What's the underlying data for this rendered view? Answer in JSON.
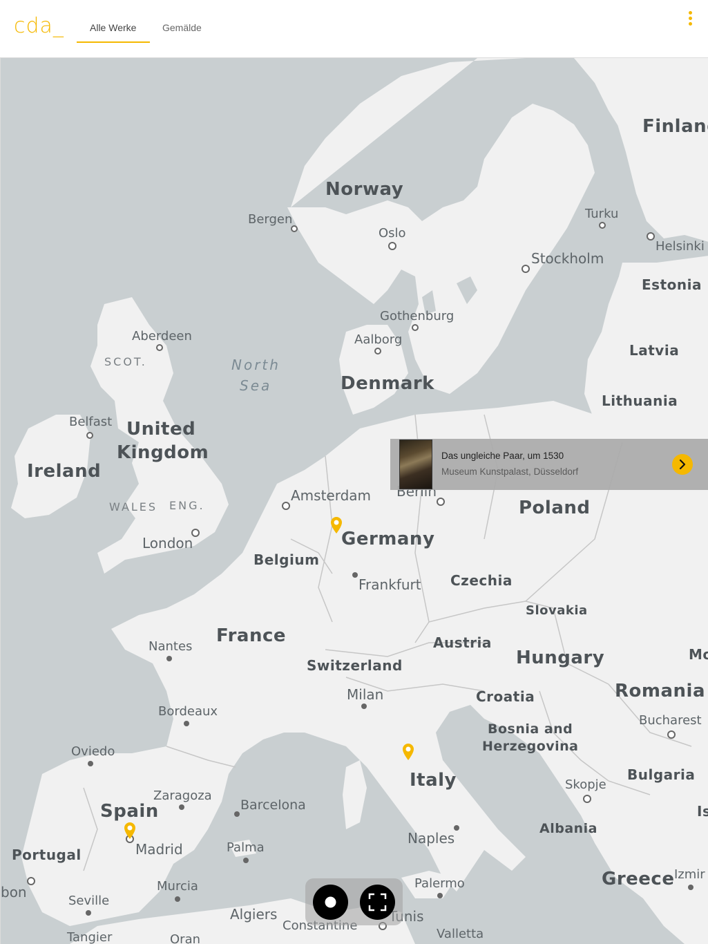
{
  "header": {
    "logo": "cda_",
    "tabs": [
      {
        "label": "Alle Werke",
        "active": true
      },
      {
        "label": "Gemälde",
        "active": false
      }
    ],
    "menu_icon": "more-vertical-icon",
    "accent_color": "#f5b800"
  },
  "map": {
    "countries": [
      "Finland",
      "Norway",
      "Estonia",
      "Latvia",
      "Lithuania",
      "Denmark",
      "United Kingdom",
      "Ireland",
      "Poland",
      "Germany",
      "Belgium",
      "Czechia",
      "Slovakia",
      "France",
      "Austria",
      "Hungary",
      "Switzerland",
      "Romania",
      "Croatia",
      "Bosnia and",
      "Herzegovina",
      "Italy",
      "Bulgaria",
      "Spain",
      "Portugal",
      "Albania",
      "Greece",
      "Mo",
      "Is"
    ],
    "cities": [
      "Bergen",
      "Oslo",
      "Turku",
      "Helsinki",
      "Stockholm",
      "Gothenburg",
      "Aalborg",
      "Aberdeen",
      "Belfast",
      "Amsterdam",
      "Berlin",
      "London",
      "Frankfurt",
      "Nantes",
      "Milan",
      "Bordeaux",
      "Bucharest",
      "Oviedo",
      "Zaragoza",
      "Barcelona",
      "Skopje",
      "Madrid",
      "Palma",
      "Naples",
      "Portugal",
      "bon",
      "Seville",
      "Murcia",
      "Palermo",
      "Algiers",
      "Tunis",
      "Constantine",
      "Tangier",
      "Oran",
      "Valletta",
      "Izmir"
    ],
    "regions": [
      "SCOT.",
      "WALES",
      "ENG."
    ],
    "seas": [
      "North",
      "Sea"
    ]
  },
  "popup": {
    "title": "Das ungleiche Paar, um 1530",
    "subtitle": "Museum Kunstpalast, Düsseldorf",
    "arrow_icon": "chevron-right-icon"
  },
  "controls": {
    "record_icon": "record-dot-icon",
    "fullscreen_icon": "fullscreen-icon"
  }
}
